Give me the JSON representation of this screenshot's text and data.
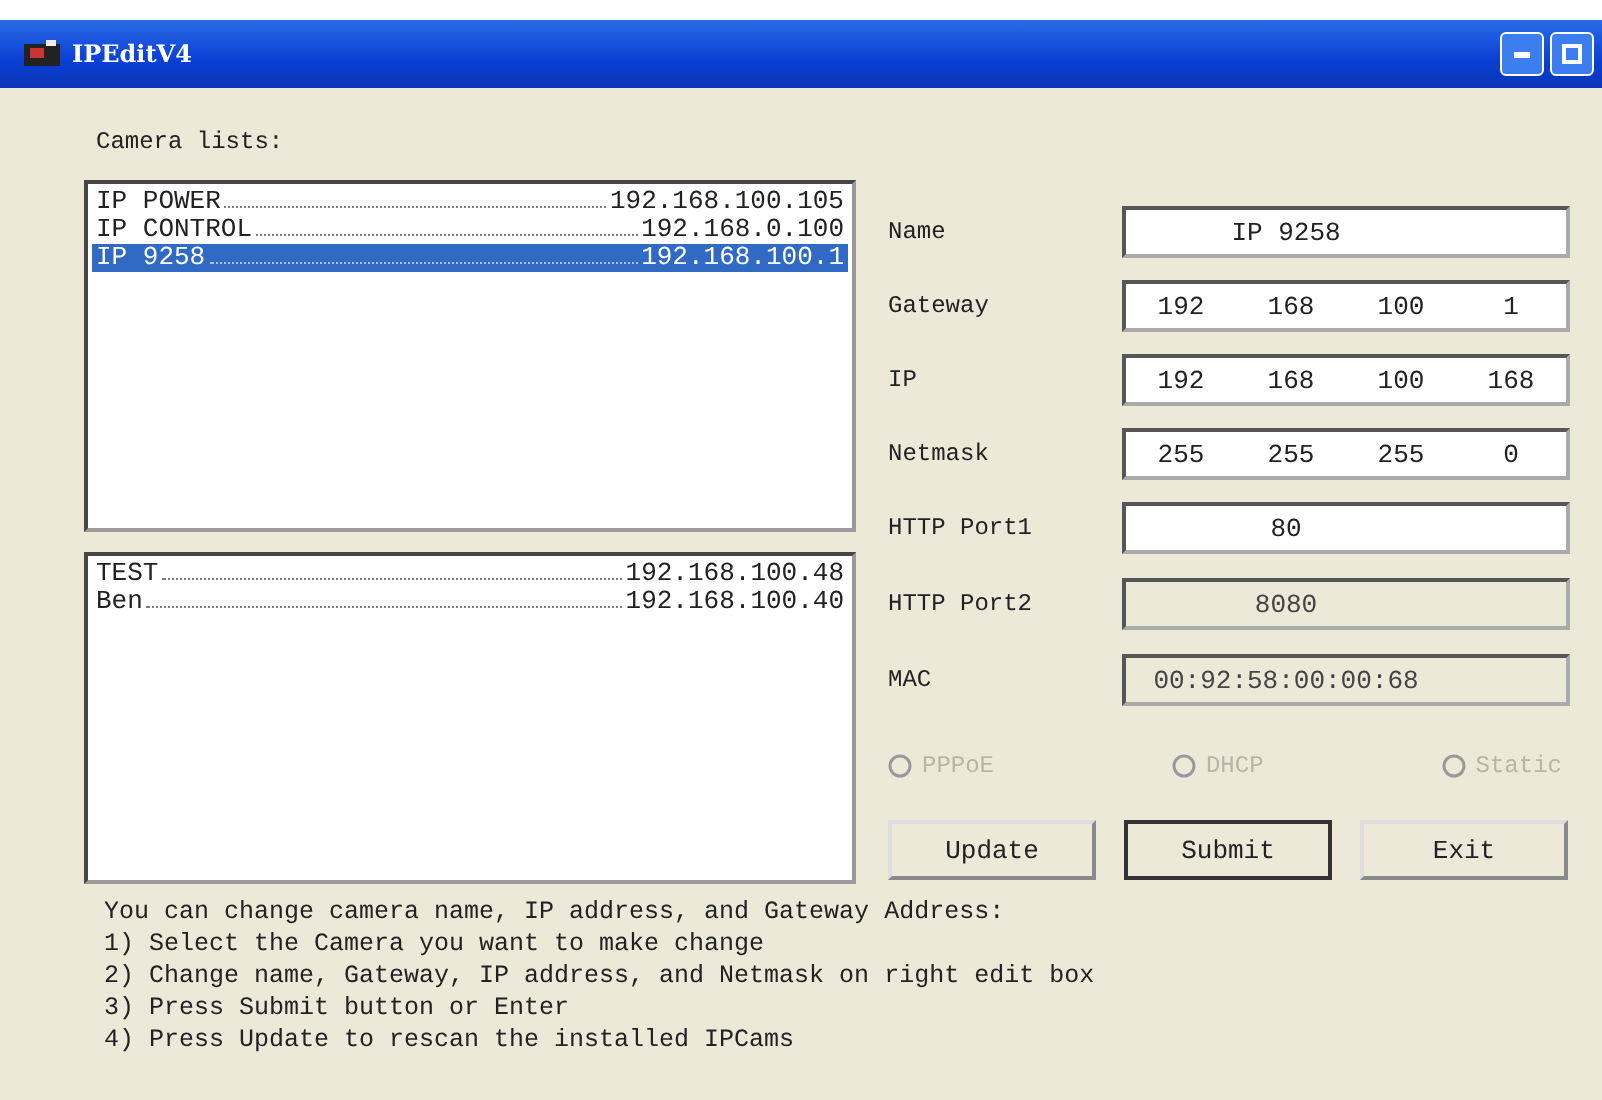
{
  "window": {
    "title": "IPEditV4"
  },
  "camera_lists_label": "Camera lists:",
  "list_primary": [
    {
      "name": "IP POWER",
      "ip": "192.168.100.105",
      "selected": false
    },
    {
      "name": "IP CONTROL",
      "ip": "192.168.0.100",
      "selected": false
    },
    {
      "name": "IP 9258",
      "ip": "192.168.100.1",
      "selected": true
    }
  ],
  "list_secondary": [
    {
      "name": "TEST",
      "ip": "192.168.100.48",
      "selected": false
    },
    {
      "name": "Ben",
      "ip": "192.168.100.40",
      "selected": false
    }
  ],
  "fields": [
    {
      "label": "Name",
      "kind": "text",
      "value": "IP 9258",
      "disabled": false
    },
    {
      "label": "Gateway",
      "kind": "address",
      "parts": [
        "192",
        "168",
        "100",
        "1"
      ],
      "disabled": false
    },
    {
      "label": "IP",
      "kind": "address",
      "parts": [
        "192",
        "168",
        "100",
        "168"
      ],
      "disabled": false
    },
    {
      "label": "Netmask",
      "kind": "address",
      "parts": [
        "255",
        "255",
        "255",
        "0"
      ],
      "disabled": false
    },
    {
      "label": "HTTP Port1",
      "kind": "text",
      "value": "80",
      "disabled": false
    },
    {
      "label": "HTTP Port2",
      "kind": "text",
      "value": "8080",
      "disabled": true
    },
    {
      "label": "MAC",
      "kind": "text",
      "value": "00:92:58:00:00:68",
      "disabled": true
    }
  ],
  "radios": [
    {
      "label": "PPPoE",
      "selected": false,
      "disabled": true
    },
    {
      "label": "DHCP",
      "selected": false,
      "disabled": true
    },
    {
      "label": "Static",
      "selected": false,
      "disabled": true
    }
  ],
  "buttons": [
    {
      "label": "Update",
      "default": false
    },
    {
      "label": "Submit",
      "default": true
    },
    {
      "label": "Exit",
      "default": false
    }
  ],
  "instructions": [
    "You can change camera name, IP address, and Gateway Address:",
    "1) Select the Camera you want to make change",
    "2) Change name, Gateway, IP address, and Netmask on right edit box",
    "3) Press Submit button or Enter",
    "4) Press Update to rescan the installed IPCams"
  ]
}
